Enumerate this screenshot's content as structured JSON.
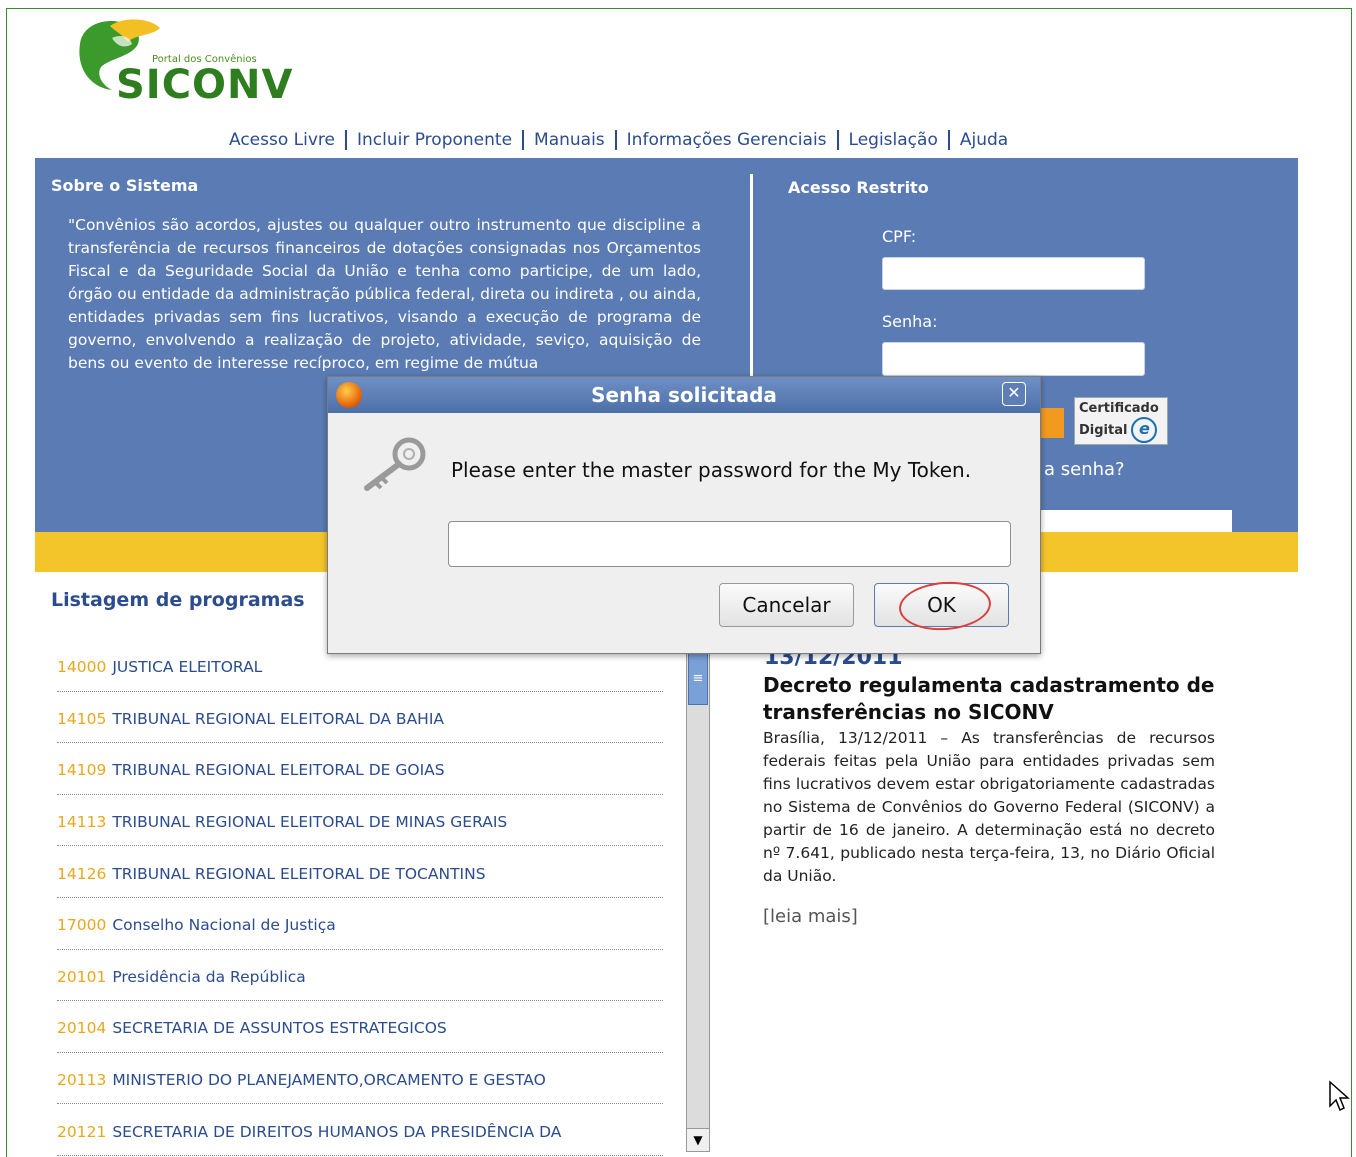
{
  "brand": {
    "portal_label": "Portal dos Convênios",
    "name": "SICONV"
  },
  "topnav": [
    "Acesso Livre",
    "Incluir Proponente",
    "Manuais",
    "Informações Gerenciais",
    "Legislação",
    "Ajuda"
  ],
  "sobre": {
    "title": "Sobre o Sistema",
    "text": "\"Convênios são acordos, ajustes ou qualquer outro instrumento que discipline a transferência de recursos financeiros de dotações consignadas nos Orçamentos Fiscal e da Seguridade Social da União e tenha como participe, de um lado, órgão ou entidade da administração pública federal, direta ou indireta , ou ainda, entidades privadas sem fins lucrativos, visando a execução de programa de governo, envolvendo a realização de projeto, atividade, seviço, aquisição de bens ou evento de interesse recíproco, em regime de mútua"
  },
  "acesso": {
    "title": "Acesso Restrito",
    "cpf_label": "CPF:",
    "senha_label": "Senha:",
    "cert_line1": "Certificado",
    "cert_line2": "Digital",
    "cert_symbol": "e",
    "forgot_fragment": "a senha?"
  },
  "listagem": {
    "title": "Listagem de programas",
    "items": [
      {
        "code": "14000",
        "name": "JUSTICA ELEITORAL"
      },
      {
        "code": "14105",
        "name": "TRIBUNAL REGIONAL ELEITORAL DA BAHIA"
      },
      {
        "code": "14109",
        "name": "TRIBUNAL REGIONAL ELEITORAL DE GOIAS"
      },
      {
        "code": "14113",
        "name": "TRIBUNAL REGIONAL ELEITORAL DE MINAS GERAIS"
      },
      {
        "code": "14126",
        "name": "TRIBUNAL REGIONAL ELEITORAL DE TOCANTINS"
      },
      {
        "code": "17000",
        "name": "Conselho Nacional de Justiça"
      },
      {
        "code": "20101",
        "name": "Presidência da República"
      },
      {
        "code": "20104",
        "name": "SECRETARIA DE ASSUNTOS ESTRATEGICOS"
      },
      {
        "code": "20113",
        "name": "MINISTERIO DO PLANEJAMENTO,ORCAMENTO E GESTAO"
      },
      {
        "code": "20121",
        "name": "SECRETARIA DE DIREITOS HUMANOS DA PRESIDÊNCIA DA"
      }
    ]
  },
  "news": {
    "date": "13/12/2011",
    "title": "Decreto regulamenta cadastramento de transferências no SICONV",
    "body": "Brasília, 13/12/2011 – As transferências de recursos federais feitas pela União para entidades privadas sem fins lucrativos devem estar obrigatoriamente cadastradas no Sistema de Convênios do Governo Federal (SICONV) a partir de 16 de janeiro. A determinação está no decreto nº 7.641, publicado nesta terça-feira, 13, no Diário Oficial da União.",
    "read_more": "[leia mais]"
  },
  "dialog": {
    "title": "Senha solicitada",
    "close_symbol": "✕",
    "message": "Please enter the master password for the My Token.",
    "cancel_label": "Cancelar",
    "ok_label": "OK"
  },
  "colors": {
    "band_blue": "#5b7bb4",
    "band_yellow": "#f4c52a",
    "link_blue": "#2b4c8f",
    "code_orange": "#e8a81e",
    "annotation_red": "#d94040"
  }
}
